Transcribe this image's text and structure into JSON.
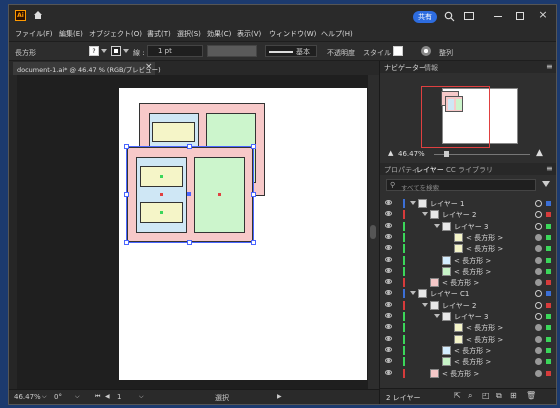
{
  "app": {
    "logo": "Ai"
  },
  "titlebar": {
    "share_label": "共有"
  },
  "menu": [
    "ファイル(F)",
    "編集(E)",
    "オブジェクト(O)",
    "書式(T)",
    "選択(S)",
    "効果(C)",
    "表示(V)",
    "ウィンドウ(W)",
    "ヘルプ(H)"
  ],
  "control": {
    "object_type": "長方形",
    "fill_swatch": "?",
    "stroke_label": "線 :",
    "stroke_weight": "1 pt",
    "brush_label": "基本",
    "opacity_label": "不透明度",
    "style_label": "スタイル :",
    "align_label": "整列"
  },
  "tab": {
    "doc_name": "document-1.ai* @ 46.47 % (RGB/プレビュー)",
    "close": "×"
  },
  "status": {
    "zoom": "46.47%",
    "rotation": "0°",
    "artboard": "1",
    "mode": "選択"
  },
  "panel_tabs_top": [
    "ナビゲーター",
    "情報"
  ],
  "navigator": {
    "zoom": "46.47%"
  },
  "panel_tabs_mid": [
    "プロパティ",
    "レイヤー",
    "CC ライブラリ"
  ],
  "layers_search_placeholder": "すべてを検索",
  "layers": [
    {
      "name": "レイヤー 1",
      "indent": 0,
      "expanded": true,
      "type": "layer",
      "color": "#3b6fd6"
    },
    {
      "name": "レイヤー 2",
      "indent": 1,
      "expanded": true,
      "type": "layer",
      "color": "#d63b3b"
    },
    {
      "name": "レイヤー 3",
      "indent": 2,
      "expanded": true,
      "type": "layer",
      "color": "#3bd65a"
    },
    {
      "name": "< 長方形 >",
      "indent": 3,
      "type": "rect",
      "thumb": "#f4f4c8",
      "color": "#3bd65a"
    },
    {
      "name": "< 長方形 >",
      "indent": 3,
      "type": "rect",
      "thumb": "#f4f4c8",
      "color": "#3bd65a"
    },
    {
      "name": "< 長方形 >",
      "indent": 2,
      "type": "rect",
      "thumb": "#d4eeff",
      "color": "#3bd65a"
    },
    {
      "name": "< 長方形 >",
      "indent": 2,
      "type": "rect",
      "thumb": "#c8f4c8",
      "color": "#3bd65a"
    },
    {
      "name": "< 長方形 >",
      "indent": 1,
      "type": "rect",
      "thumb": "#f4c8c8",
      "color": "#d63b3b"
    },
    {
      "name": "レイヤー C1",
      "indent": 0,
      "expanded": true,
      "type": "layer",
      "color": "#3b6fd6"
    },
    {
      "name": "レイヤー 2",
      "indent": 1,
      "expanded": true,
      "type": "layer",
      "color": "#d63b3b"
    },
    {
      "name": "レイヤー 3",
      "indent": 2,
      "expanded": true,
      "type": "layer",
      "color": "#3bd65a"
    },
    {
      "name": "< 長方形 >",
      "indent": 3,
      "type": "rect",
      "thumb": "#f4f4c8",
      "color": "#3bd65a"
    },
    {
      "name": "< 長方形 >",
      "indent": 3,
      "type": "rect",
      "thumb": "#f4f4c8",
      "color": "#3bd65a"
    },
    {
      "name": "< 長方形 >",
      "indent": 2,
      "type": "rect",
      "thumb": "#d4eeff",
      "color": "#3bd65a"
    },
    {
      "name": "< 長方形 >",
      "indent": 2,
      "type": "rect",
      "thumb": "#c8f4c8",
      "color": "#3bd65a"
    },
    {
      "name": "< 長方形 >",
      "indent": 1,
      "type": "rect",
      "thumb": "#f4c8c8",
      "color": "#d63b3b"
    }
  ],
  "layers_footer": {
    "count": "2 レイヤー"
  },
  "colors": {
    "accent": "#2d6cdf",
    "selection": "#4a66ff",
    "pink": "#f7c9c9",
    "lightblue": "#cfe7f5",
    "green": "#ccf5cc",
    "yellow": "#f5f5c8"
  }
}
